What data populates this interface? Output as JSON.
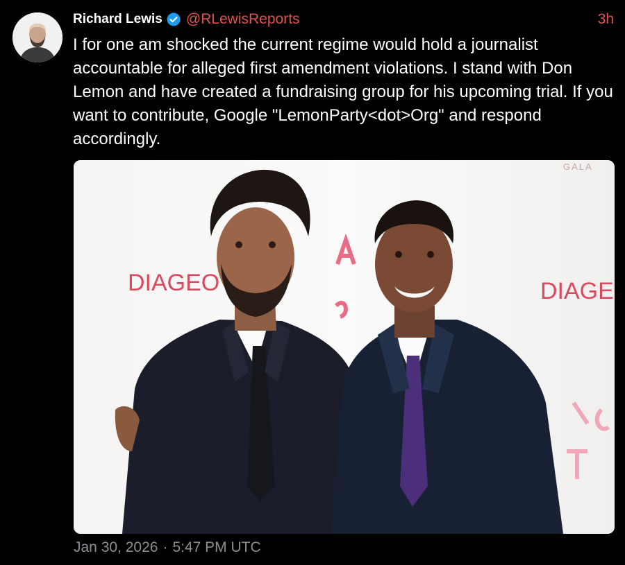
{
  "author": {
    "display_name": "Richard Lewis",
    "handle": "@RLewisReports",
    "verified": true,
    "avatar_icon": "user-avatar"
  },
  "tweet": {
    "time_ago": "3h",
    "text": "I for one am shocked the current regime would hold a journalist accountable for alleged first amendment violations. I stand with Don Lemon and have created a fundraising group for his upcoming trial. If you want to contribute, Google \"LemonParty<dot>Org\" and respond accordingly.",
    "date": "Jan 30, 2026",
    "separator": "·",
    "time": "5:47 PM UTC"
  },
  "media": {
    "type": "photo",
    "backdrop_text": {
      "left_sponsor": "DIAGEO",
      "right_sponsor": "DIAGEO",
      "top_right": "GALA"
    }
  },
  "colors": {
    "background": "#000000",
    "text": "#ffffff",
    "accent": "#e0534d",
    "muted": "#8b8f94",
    "verified_badge": "#1d9bf0"
  }
}
